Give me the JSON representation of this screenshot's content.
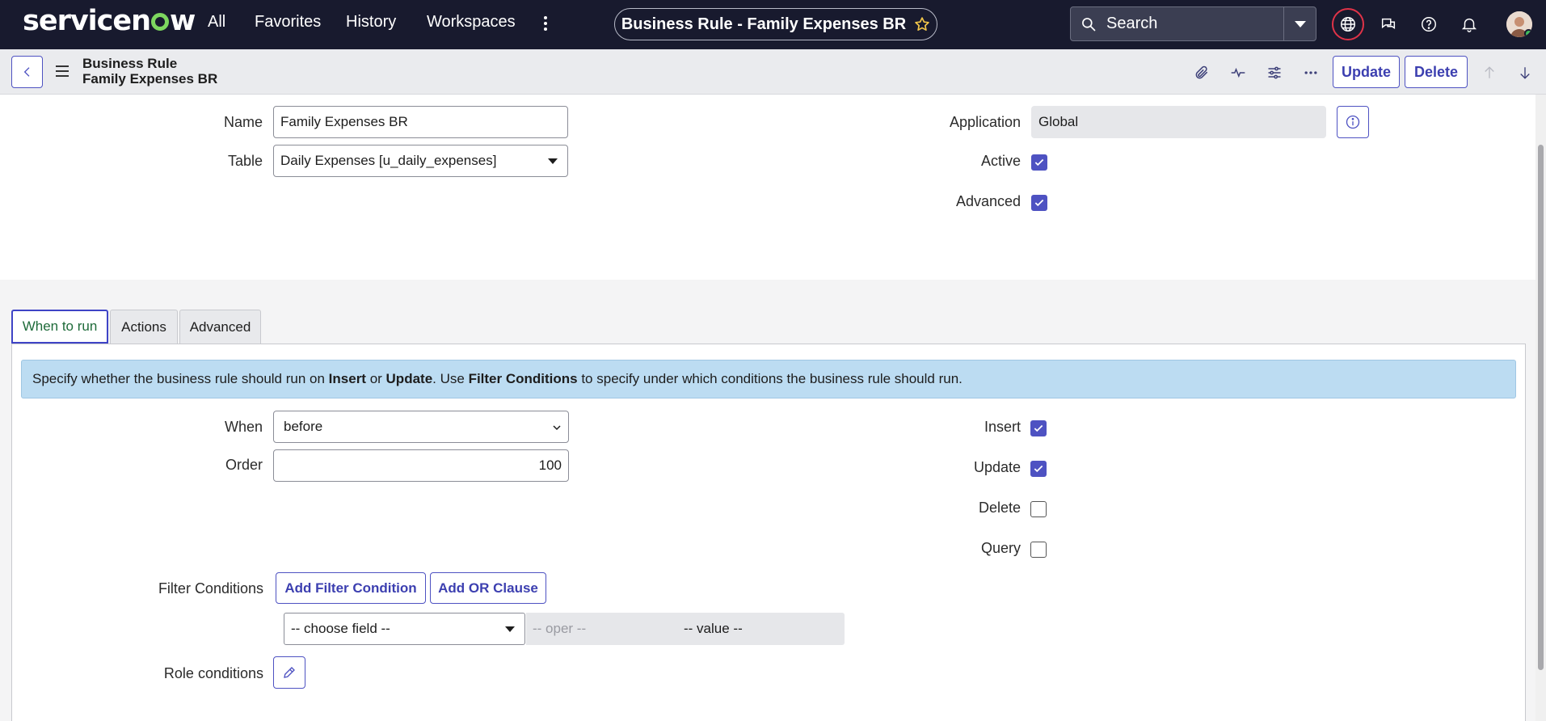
{
  "nav": {
    "logo": "servicenow",
    "links": [
      "All",
      "Favorites",
      "History",
      "Workspaces"
    ],
    "title": "Business Rule - Family Expenses BR",
    "search_label": "Search"
  },
  "header": {
    "record_type": "Business Rule",
    "record_name": "Family Expenses BR",
    "update_label": "Update",
    "delete_label": "Delete"
  },
  "form": {
    "name_label": "Name",
    "name_value": "Family Expenses BR",
    "table_label": "Table",
    "table_value": "Daily Expenses [u_daily_expenses]",
    "application_label": "Application",
    "application_value": "Global",
    "active_label": "Active",
    "active_checked": true,
    "advanced_label": "Advanced",
    "advanced_checked": true
  },
  "tabs": [
    "When to run",
    "Actions",
    "Advanced"
  ],
  "when_to_run": {
    "info_parts": [
      "Specify whether the business rule should run on ",
      "Insert",
      " or ",
      "Update",
      ". Use ",
      "Filter Conditions",
      " to specify under which conditions the business rule should run."
    ],
    "when_label": "When",
    "when_value": "before",
    "order_label": "Order",
    "order_value": "100",
    "insert_label": "Insert",
    "update_label": "Update",
    "delete_label": "Delete",
    "query_label": "Query",
    "insert_checked": true,
    "update_checked": true,
    "delete_checked": false,
    "query_checked": false,
    "filter_label": "Filter Conditions",
    "add_filter_label": "Add Filter Condition",
    "add_or_label": "Add OR Clause",
    "choose_field": "-- choose field --",
    "oper": "-- oper --",
    "value": "-- value --",
    "role_label": "Role conditions"
  },
  "colors": {
    "nav_bg": "#181a2e",
    "accent": "#4e52c2",
    "logo_green": "#7dd75f",
    "info_bg": "#bcdcf2"
  }
}
